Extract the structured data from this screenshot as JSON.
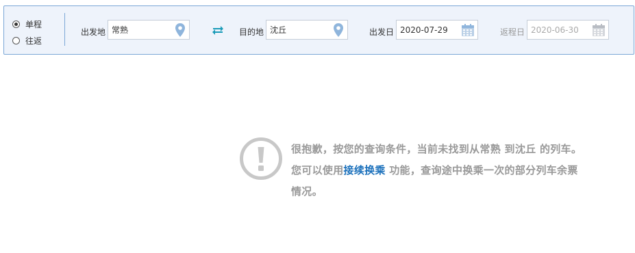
{
  "trip_type": {
    "options": [
      "单程",
      "往返"
    ],
    "selected": "单程"
  },
  "search": {
    "from_label": "出发地",
    "from_value": "常熟",
    "to_label": "目的地",
    "to_value": "沈丘",
    "depart_label": "出发日",
    "depart_value": "2020-07-29",
    "return_label": "返程日",
    "return_value": "2020-06-30"
  },
  "icons": {
    "location": "map-pin-icon",
    "swap": "swap-arrows-icon",
    "calendar": "calendar-icon",
    "warning": "exclamation-circle-icon"
  },
  "colors": {
    "accent": "#1a70bb",
    "pin": "#8fb5dc",
    "swap": "#1a9bb8",
    "notice_text": "#999999",
    "bar_border": "#7ba7d6"
  },
  "notice": {
    "part1": "很抱歉，按您的查询条件，当前未找到从常熟 到沈丘 的列车。您可以使用",
    "link": "接续换乘",
    "part2": " 功能，查询途中换乘一次的部分列车余票情况。"
  }
}
